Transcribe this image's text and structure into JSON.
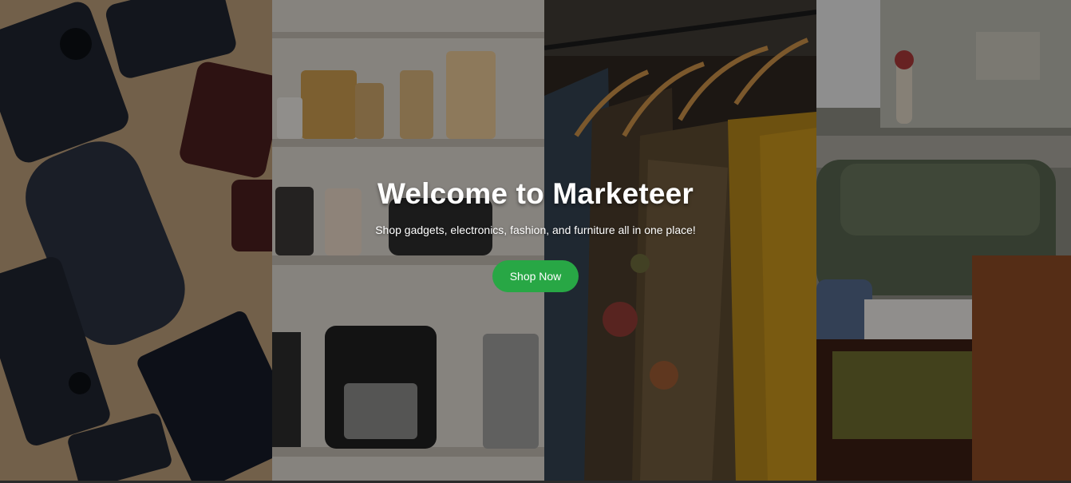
{
  "hero": {
    "title": "Welcome to Marketeer",
    "subtitle": "Shop gadgets, electronics, fashion, and furniture all in one place!",
    "cta_label": "Shop Now",
    "overlay_color": "#000000",
    "cta_color": "#28a745"
  },
  "panels": [
    {
      "name": "gadgets"
    },
    {
      "name": "electronics"
    },
    {
      "name": "fashion"
    },
    {
      "name": "furniture"
    }
  ]
}
